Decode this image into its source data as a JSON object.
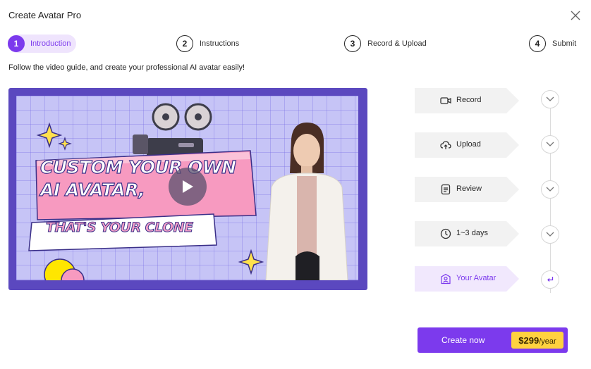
{
  "window": {
    "title": "Create Avatar Pro"
  },
  "steps": [
    {
      "num": "1",
      "label": "Introduction",
      "active": true
    },
    {
      "num": "2",
      "label": "Instructions",
      "active": false
    },
    {
      "num": "3",
      "label": "Record & Upload",
      "active": false
    },
    {
      "num": "4",
      "label": "Submit",
      "active": false
    }
  ],
  "subtitle": "Follow the video guide, and create your professional AI avatar easily!",
  "video": {
    "headline_1": "CUSTOM YOUR OWN",
    "headline_2": "AI AVATAR,",
    "headline_3": "THAT'S YOUR CLONE"
  },
  "timeline": [
    {
      "label": "Record",
      "icon": "video-camera-icon"
    },
    {
      "label": "Upload",
      "icon": "cloud-upload-icon"
    },
    {
      "label": "Review",
      "icon": "document-icon"
    },
    {
      "label": "1~3 days",
      "icon": "clock-icon"
    },
    {
      "label": "Your Avatar",
      "icon": "avatar-icon"
    }
  ],
  "create_button": {
    "label": "Create now",
    "price": "$299",
    "period": "/year"
  },
  "colors": {
    "accent": "#7c3aed",
    "accent_light": "#efe4fd",
    "price_badge": "#ffd23f",
    "video_frame": "#5b48bf"
  }
}
